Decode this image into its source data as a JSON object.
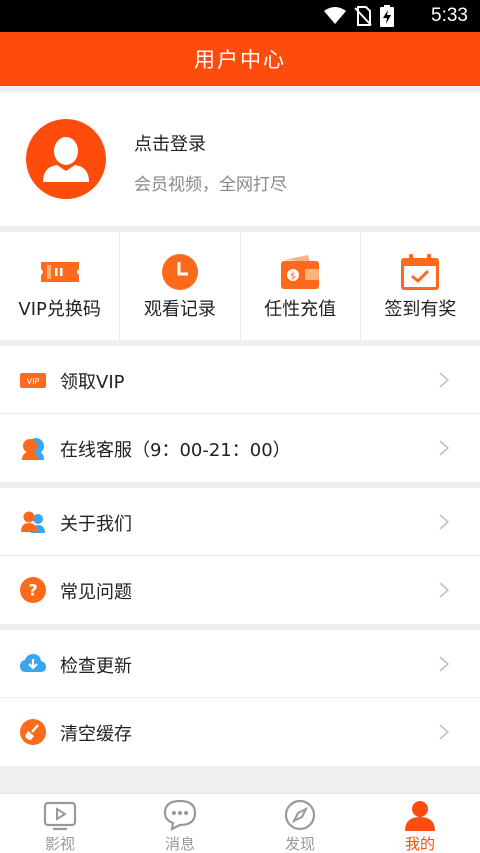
{
  "status_bar": {
    "time": "5:33",
    "icons": [
      "wifi-icon",
      "no-sim-icon",
      "battery-charging-icon"
    ]
  },
  "header": {
    "title": "用户中心"
  },
  "profile": {
    "login_label": "点击登录",
    "slogan": "会员视频，全网打尽"
  },
  "quick_actions": [
    {
      "label": "VIP兑换码",
      "icon": "ticket-icon"
    },
    {
      "label": "观看记录",
      "icon": "clock-icon"
    },
    {
      "label": "任性充值",
      "icon": "wallet-icon"
    },
    {
      "label": "签到有奖",
      "icon": "calendar-check-icon"
    }
  ],
  "menu_groups": [
    [
      {
        "label": "领取VIP",
        "icon": "vip-icon"
      },
      {
        "label": "在线客服（9：00-21：00）",
        "icon": "customer-service-icon"
      }
    ],
    [
      {
        "label": "关于我们",
        "icon": "people-icon"
      },
      {
        "label": "常见问题",
        "icon": "question-icon"
      }
    ],
    [
      {
        "label": "检查更新",
        "icon": "cloud-download-icon"
      },
      {
        "label": "清空缓存",
        "icon": "broom-icon"
      }
    ]
  ],
  "bottom_nav": [
    {
      "label": "影视",
      "icon": "play-icon",
      "active": false
    },
    {
      "label": "消息",
      "icon": "chat-icon",
      "active": false
    },
    {
      "label": "发现",
      "icon": "compass-icon",
      "active": false
    },
    {
      "label": "我的",
      "icon": "user-icon",
      "active": true
    }
  ],
  "colors": {
    "accent": "#fe4c0c",
    "background": "#efeff2",
    "text": "#222222",
    "secondary_text": "#888888",
    "nav_inactive": "#999999"
  }
}
